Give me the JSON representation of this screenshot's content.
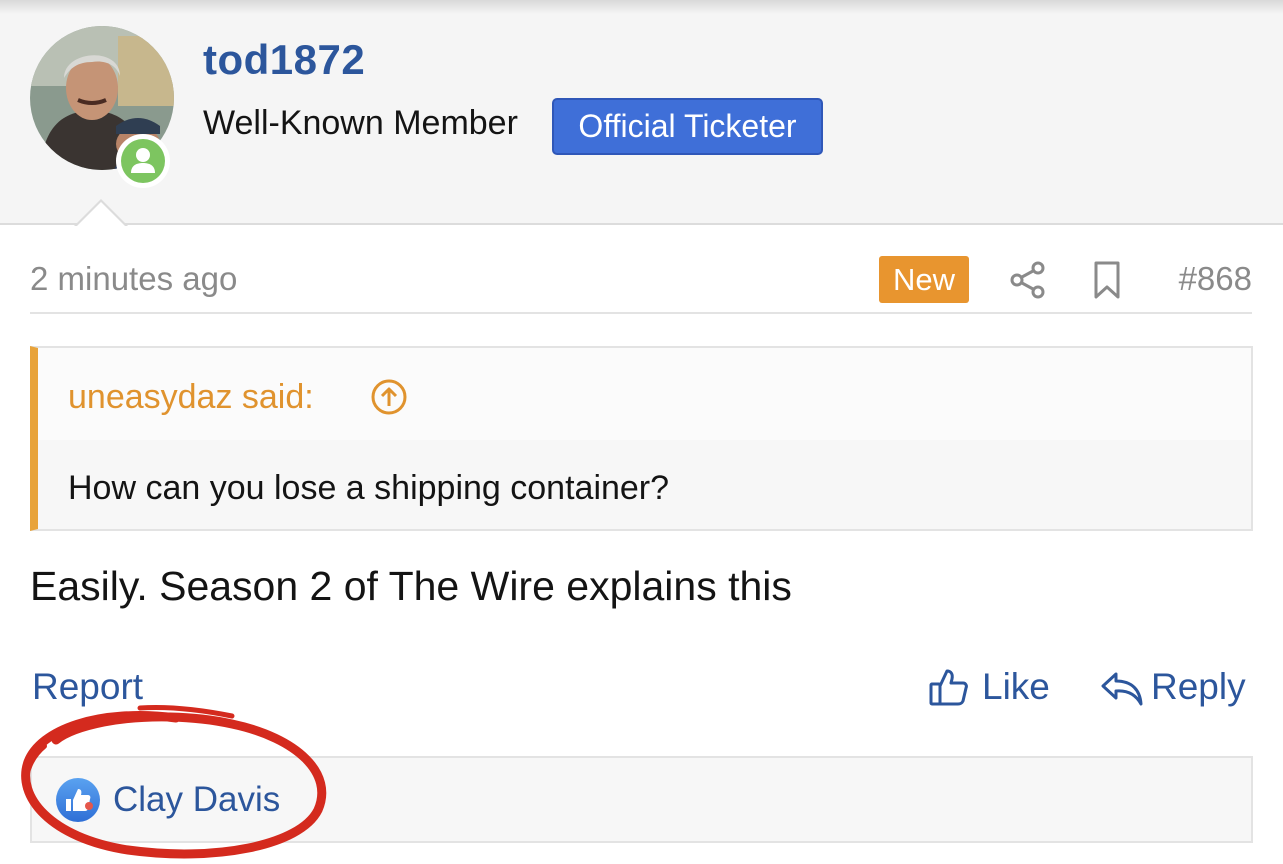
{
  "author": {
    "username": "tod1872",
    "user_title": "Well-Known Member",
    "banner": "Official Ticketer",
    "status": "online"
  },
  "post": {
    "timestamp": "2 minutes ago",
    "new_badge": "New",
    "number": "#868",
    "quote": {
      "author_label": "uneasydaz said:",
      "text": "How can you lose a shipping container?"
    },
    "body": "Easily. Season 2 of The Wire explains this"
  },
  "actions": {
    "report": "Report",
    "like": "Like",
    "reply": "Reply"
  },
  "reactions": {
    "users": [
      "Clay Davis"
    ]
  },
  "colors": {
    "link": "#2c569c",
    "banner": "#3f6fd8",
    "new_badge": "#e8952f",
    "quote_accent": "#e8a33a",
    "online": "#7dc560",
    "annotation": "#d42a1e"
  },
  "icons": {
    "share": "share-icon",
    "bookmark": "bookmark-icon",
    "quote_jump": "arrow-up-circle-icon",
    "like": "thumbs-up-icon",
    "reply": "reply-arrow-icon",
    "reaction": "like-reaction-icon"
  }
}
